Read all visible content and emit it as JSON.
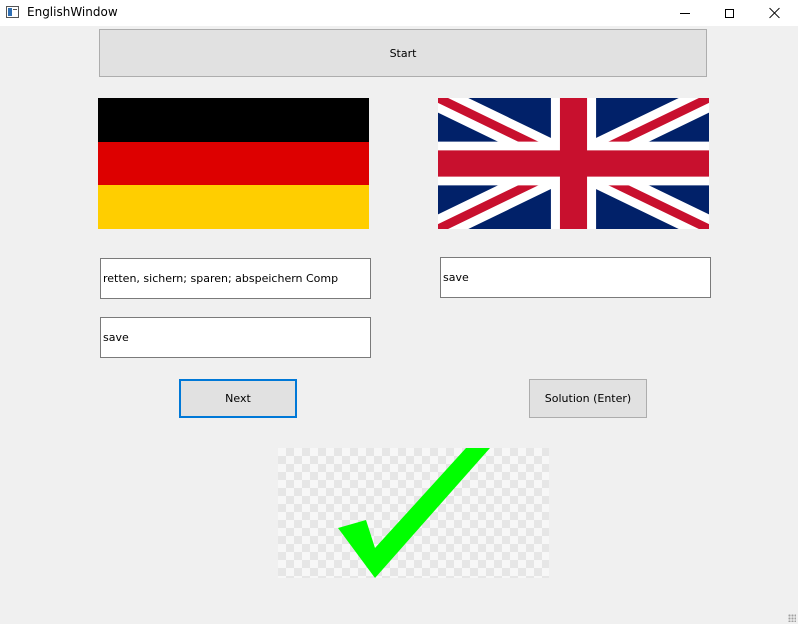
{
  "window": {
    "title": "EnglishWindow"
  },
  "start_button": {
    "label": "Start"
  },
  "german_flag": {
    "colors": [
      "#000000",
      "#dd0000",
      "#ffce00"
    ]
  },
  "uk_flag": {
    "colors": {
      "blue": "#012169",
      "red": "#c8102e",
      "white": "#ffffff"
    }
  },
  "fields": {
    "german_word": "retten, sichern; sparen; abspeichern Comp",
    "english_word": "save",
    "user_answer": "save"
  },
  "buttons": {
    "next_label": "Next",
    "solution_label": "Solution (Enter)"
  },
  "result": {
    "icon": "checkmark-icon",
    "color": "#00ff00"
  },
  "colors": {
    "focus_accent": "#0078d7",
    "button_bg": "#e1e1e1",
    "window_bg": "#f0f0f0"
  }
}
